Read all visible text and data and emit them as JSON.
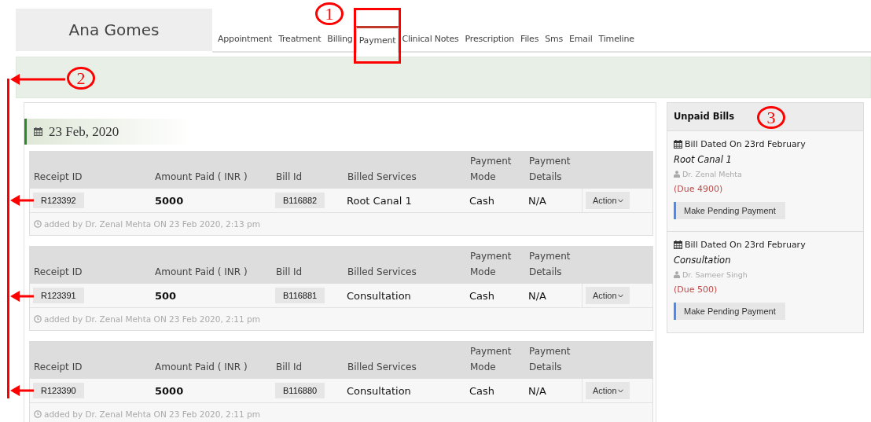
{
  "patient": {
    "name": "Ana Gomes"
  },
  "tabs": [
    {
      "label": "Appointment",
      "selected": false
    },
    {
      "label": "Treatment",
      "selected": false
    },
    {
      "label": "Billing",
      "selected": false
    },
    {
      "label": "Payment",
      "selected": true
    },
    {
      "label": "Clinical Notes",
      "selected": false
    },
    {
      "label": "Prescription",
      "selected": false
    },
    {
      "label": "Files",
      "selected": false
    },
    {
      "label": "Sms",
      "selected": false
    },
    {
      "label": "Email",
      "selected": false
    },
    {
      "label": "Timeline",
      "selected": false
    }
  ],
  "payments": {
    "date": "23 Feb, 2020",
    "receipts": [
      {
        "columns": [
          "Receipt ID",
          "Amount Paid ( INR )",
          "Bill Id",
          "Billed Services",
          "Payment Mode",
          "Payment Details"
        ],
        "receipt_id": "R123392",
        "amount": "5000",
        "bill_id": "B116882",
        "service": "Root Canal 1",
        "mode": "Cash",
        "details": "N/A",
        "action": "Action",
        "added": "added by Dr. Zenal Mehta ON 23 Feb 2020, 2:13 pm"
      },
      {
        "columns": [
          "Receipt ID",
          "Amount Paid ( INR )",
          "Bill Id",
          "Billed Services",
          "Payment Mode",
          "Payment Details"
        ],
        "receipt_id": "R123391",
        "amount": "500",
        "bill_id": "B116881",
        "service": "Consultation",
        "mode": "Cash",
        "details": "N/A",
        "action": "Action",
        "added": "added by Dr. Zenal Mehta ON 23 Feb 2020, 2:11 pm"
      },
      {
        "columns": [
          "Receipt ID",
          "Amount Paid ( INR )",
          "Bill Id",
          "Billed Services",
          "Payment Mode",
          "Payment Details"
        ],
        "receipt_id": "R123390",
        "amount": "5000",
        "bill_id": "B116880",
        "service": "Consultation",
        "mode": "Cash",
        "details": "N/A",
        "action": "Action",
        "added": "added by Dr. Zenal Mehta ON 23 Feb 2020, 2:11 pm"
      }
    ]
  },
  "unpaid_bills": {
    "title": "Unpaid Bills",
    "bills": [
      {
        "dated": "Bill Dated On 23rd February",
        "service": "Root Canal 1",
        "doctor": "Dr. Zenal Mehta",
        "due": "(Due 4900)",
        "button": "Make Pending Payment"
      },
      {
        "dated": "Bill Dated On 23rd February",
        "service": "Consultation",
        "doctor": "Dr. Sameer Singh",
        "due": "(Due 500)",
        "button": "Make Pending Payment"
      }
    ]
  },
  "annotations": [
    {
      "kind": "number",
      "label": "1"
    },
    {
      "kind": "box"
    },
    {
      "kind": "number",
      "label": "2"
    },
    {
      "kind": "bracket"
    },
    {
      "kind": "number",
      "label": "3"
    }
  ]
}
